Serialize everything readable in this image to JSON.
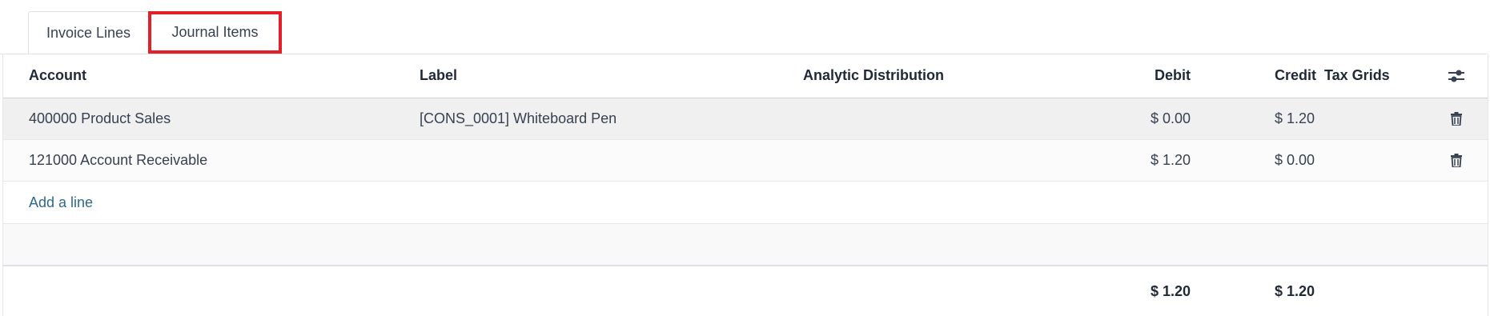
{
  "tabs": {
    "invoice_lines": "Invoice Lines",
    "journal_items": "Journal Items"
  },
  "table": {
    "headers": {
      "account": "Account",
      "label": "Label",
      "analytic": "Analytic Distribution",
      "debit": "Debit",
      "credit": "Credit",
      "tax_grids": "Tax Grids"
    },
    "rows": [
      {
        "account": "400000 Product Sales",
        "label": "[CONS_0001] Whiteboard Pen",
        "debit": "$ 0.00",
        "credit": "$ 1.20"
      },
      {
        "account": "121000 Account Receivable",
        "label": "",
        "debit": "$ 1.20",
        "credit": "$ 0.00"
      }
    ],
    "add_line": "Add a line",
    "totals": {
      "debit": "$ 1.20",
      "credit": "$ 1.20"
    }
  },
  "icons": {
    "settings": "sliders-icon",
    "delete": "trash-icon"
  },
  "colors": {
    "highlight": "#e3202a",
    "link": "#2c6a8f"
  }
}
